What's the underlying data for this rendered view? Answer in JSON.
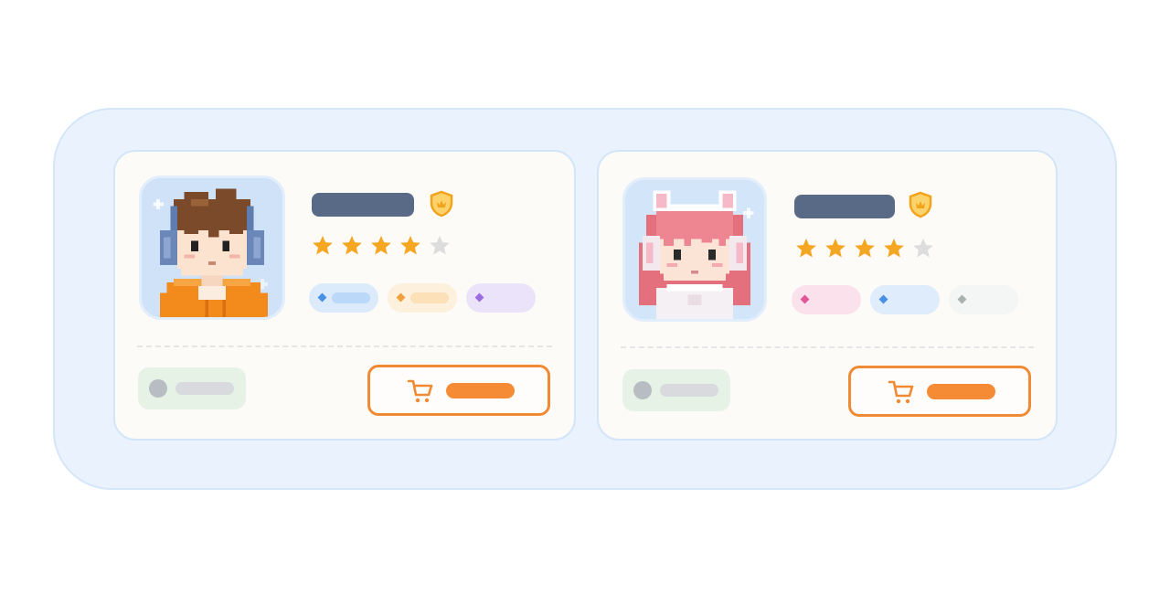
{
  "colors": {
    "panel_bg": "#eaf3fd",
    "card_bg": "#fcfbf7",
    "accent_orange": "#f28a33",
    "star_filled": "#f5a623",
    "star_empty": "#dddddd",
    "name_bar": "#586a86",
    "badge_gold": "#f2a31b"
  },
  "cards": [
    {
      "name": "",
      "badge_icon": "shield-badge-icon",
      "avatar": "pixel-boy-headphones-avatar",
      "rating": 4,
      "rating_max": 5,
      "tags": [
        {
          "label": "",
          "bg": "#dcebfc",
          "dot": "#4a8fe6",
          "line": "#bcd8f8"
        },
        {
          "label": "",
          "bg": "#fdf0dc",
          "dot": "#f2a03c",
          "line": "#fbe0b8"
        },
        {
          "label": "",
          "bg": "#ebe3fa",
          "dot": "#9b6be0",
          "line": "#ebe3fa"
        }
      ],
      "status": {
        "label": ""
      },
      "cart_button": {
        "icon": "cart-icon",
        "label": ""
      }
    },
    {
      "name": "",
      "badge_icon": "shield-badge-icon",
      "avatar": "pixel-girl-cat-ears-avatar",
      "rating": 4,
      "rating_max": 5,
      "tags": [
        {
          "label": "",
          "bg": "#fbe1ec",
          "dot": "#e25596",
          "line": "#fbe1ec"
        },
        {
          "label": "",
          "bg": "#deecfc",
          "dot": "#4a8fe6",
          "line": "#deecfc"
        },
        {
          "label": "",
          "bg": "#f4f5f5",
          "dot": "#a8b2b0",
          "line": "#f4f5f5"
        }
      ],
      "status": {
        "label": ""
      },
      "cart_button": {
        "icon": "cart-icon",
        "label": ""
      }
    }
  ]
}
